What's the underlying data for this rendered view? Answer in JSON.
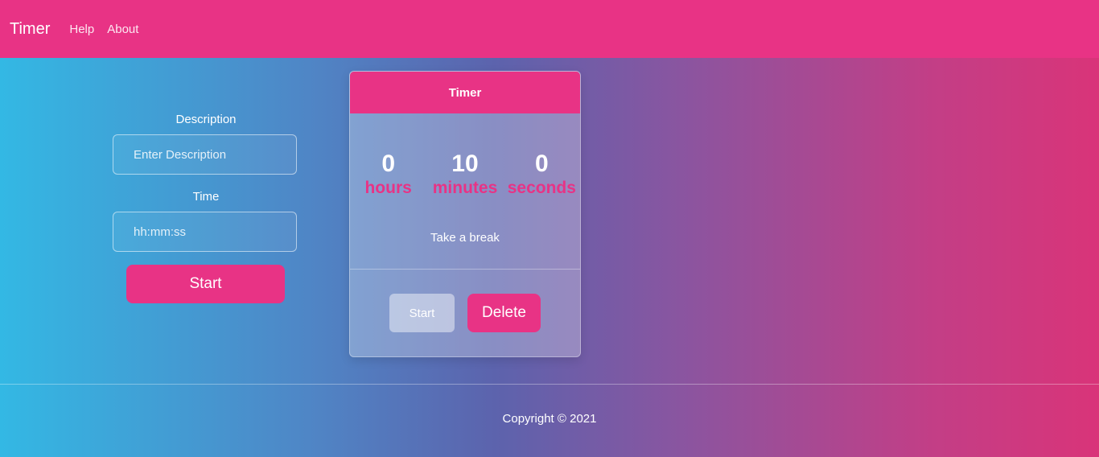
{
  "navbar": {
    "brand": "Timer",
    "links": [
      "Help",
      "About"
    ]
  },
  "form": {
    "description_label": "Description",
    "description_placeholder": "Enter Description",
    "time_label": "Time",
    "time_placeholder": "hh:mm:ss",
    "start_label": "Start"
  },
  "timer_card": {
    "title": "Timer",
    "hours": "0",
    "hours_label": "hours",
    "minutes": "10",
    "minutes_label": "minutes",
    "seconds": "0",
    "seconds_label": "seconds",
    "description": "Take a break",
    "start_label": "Start",
    "delete_label": "Delete"
  },
  "footer": {
    "copyright": "Copyright © 2021"
  },
  "colors": {
    "accent": "#e83385",
    "gradient_start": "#33b8e4",
    "gradient_end": "#d93479"
  }
}
